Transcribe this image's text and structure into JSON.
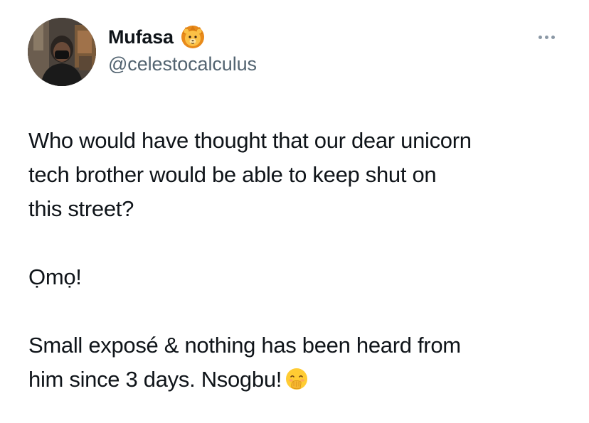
{
  "author": {
    "display_name": "Mufasa",
    "name_emoji": "lion-face-icon",
    "handle": "@celestocalculus",
    "avatar": "avatar-photo"
  },
  "menu": {
    "icon": "more-options-icon"
  },
  "tweet": {
    "lines": [
      "Who would have thought that our dear unicorn",
      "tech brother would be able to keep shut on",
      "this street?"
    ],
    "omo": "Ọmọ!",
    "closing_lines": [
      "Small exposé & nothing has been heard from",
      "him since 3 days. Nsogbu!"
    ],
    "end_emoji": "face-with-hand-over-mouth-icon"
  },
  "colors": {
    "text": "#0f1419",
    "secondary": "#536471",
    "dots": "#8b98a5",
    "lion": "#f4a722",
    "emoji_face": "#ffcc33"
  }
}
